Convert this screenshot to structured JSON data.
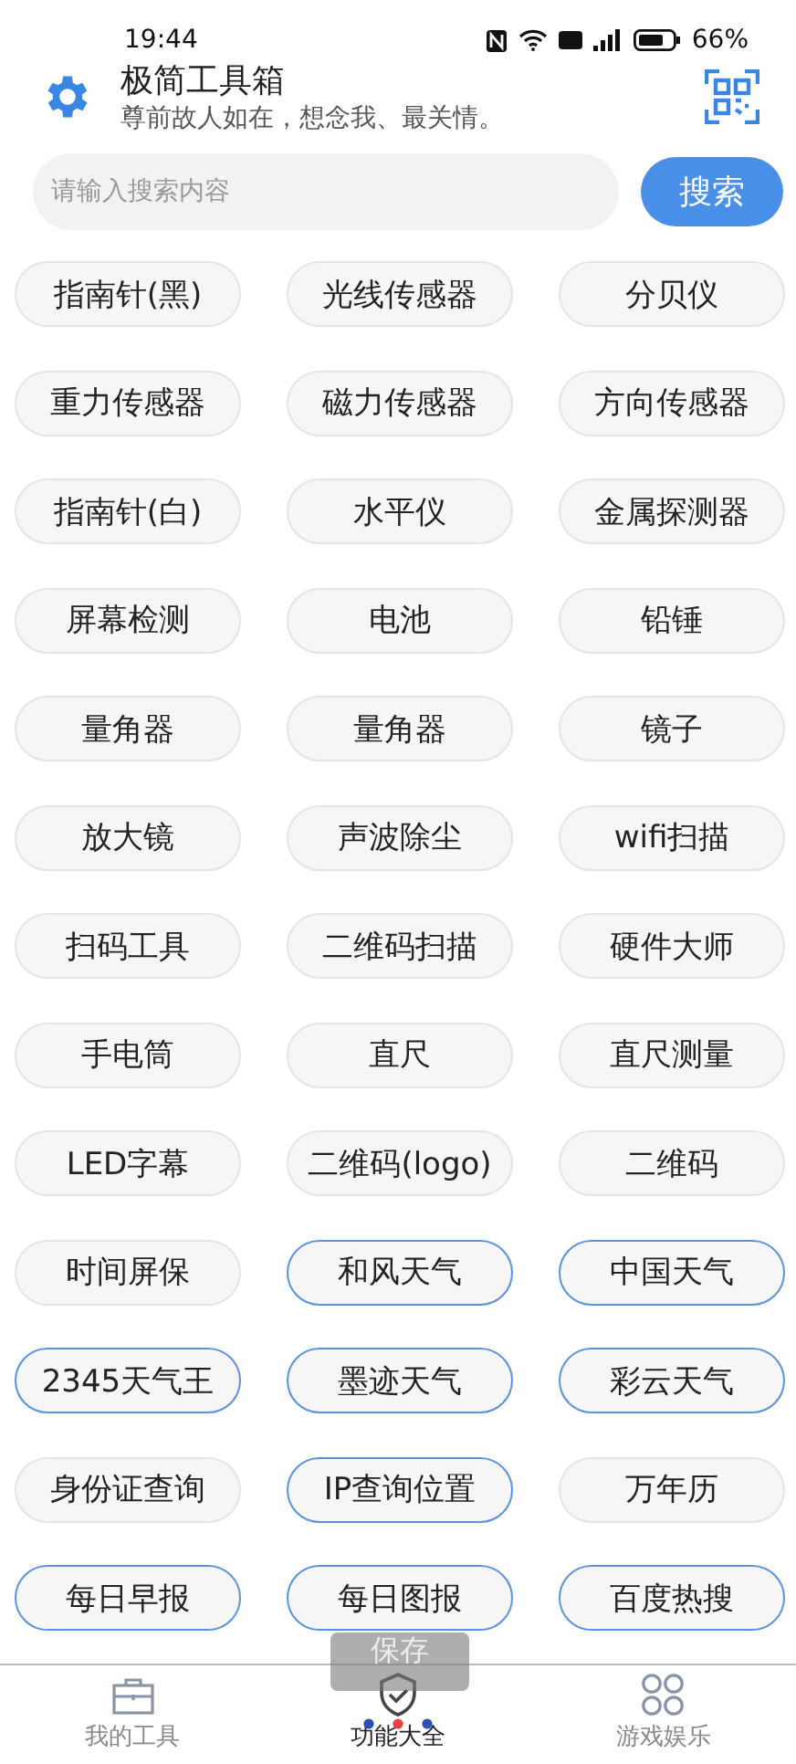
{
  "status_bar": {
    "time": "19:44",
    "battery": "66%"
  },
  "header": {
    "title": "极简工具箱",
    "subtitle": "尊前故人如在，想念我、最关情。"
  },
  "search": {
    "placeholder": "请输入搜索内容",
    "button": "搜索"
  },
  "tools": [
    {
      "label": "指南针(黑)",
      "outlined": false
    },
    {
      "label": "光线传感器",
      "outlined": false
    },
    {
      "label": "分贝仪",
      "outlined": false
    },
    {
      "label": "重力传感器",
      "outlined": false
    },
    {
      "label": "磁力传感器",
      "outlined": false
    },
    {
      "label": "方向传感器",
      "outlined": false
    },
    {
      "label": "指南针(白)",
      "outlined": false
    },
    {
      "label": "水平仪",
      "outlined": false
    },
    {
      "label": "金属探测器",
      "outlined": false
    },
    {
      "label": "屏幕检测",
      "outlined": false
    },
    {
      "label": "电池",
      "outlined": false
    },
    {
      "label": "铅锤",
      "outlined": false
    },
    {
      "label": "量角器",
      "outlined": false
    },
    {
      "label": "量角器",
      "outlined": false
    },
    {
      "label": "镜子",
      "outlined": false
    },
    {
      "label": "放大镜",
      "outlined": false
    },
    {
      "label": "声波除尘",
      "outlined": false
    },
    {
      "label": "wifi扫描",
      "outlined": false
    },
    {
      "label": "扫码工具",
      "outlined": false
    },
    {
      "label": "二维码扫描",
      "outlined": false
    },
    {
      "label": "硬件大师",
      "outlined": false
    },
    {
      "label": "手电筒",
      "outlined": false
    },
    {
      "label": "直尺",
      "outlined": false
    },
    {
      "label": "直尺测量",
      "outlined": false
    },
    {
      "label": "LED字幕",
      "outlined": false
    },
    {
      "label": "二维码(logo)",
      "outlined": false
    },
    {
      "label": "二维码",
      "outlined": false
    },
    {
      "label": "时间屏保",
      "outlined": false
    },
    {
      "label": "和风天气",
      "outlined": true
    },
    {
      "label": "中国天气",
      "outlined": true
    },
    {
      "label": "2345天气王",
      "outlined": true
    },
    {
      "label": "墨迹天气",
      "outlined": true
    },
    {
      "label": "彩云天气",
      "outlined": true
    },
    {
      "label": "身份证查询",
      "outlined": false
    },
    {
      "label": "IP查询位置",
      "outlined": true
    },
    {
      "label": "万年历",
      "outlined": false
    },
    {
      "label": "每日早报",
      "outlined": true
    },
    {
      "label": "每日图报",
      "outlined": true
    },
    {
      "label": "百度热搜",
      "outlined": true
    }
  ],
  "toast": "保存",
  "nav": [
    {
      "label": "我的工具",
      "kind": "toolbox",
      "selected": false
    },
    {
      "label": "功能大全",
      "kind": "shield",
      "selected": true
    },
    {
      "label": "游戏娱乐",
      "kind": "grid",
      "selected": false
    }
  ]
}
